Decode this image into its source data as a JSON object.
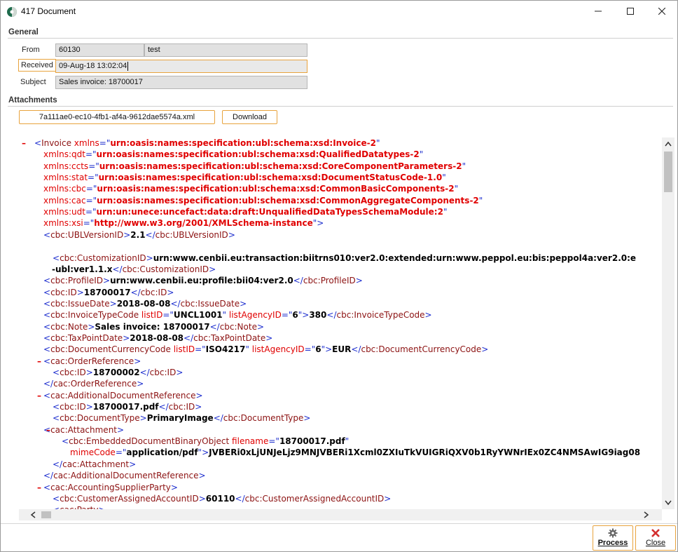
{
  "window": {
    "title": "417 Document"
  },
  "general": {
    "section_label": "General",
    "from_label": "From",
    "from_code": "60130",
    "from_name": "test",
    "received_label": "Received",
    "received_value": "09-Aug-18 13:02:04",
    "subject_label": "Subject",
    "subject_value": "Sales invoice: 18700017"
  },
  "attachments": {
    "section_label": "Attachments",
    "file_name": "7a111ae0-ec10-4fb1-af4a-9612dae5574a.xml",
    "download_label": "Download"
  },
  "xml_lines": [
    [
      {
        "c": "tg",
        "t": "<"
      },
      {
        "c": "tn",
        "t": "Invoice"
      },
      {
        "c": "an",
        "t": " xmlns"
      },
      {
        "c": "tg",
        "t": "=\""
      },
      {
        "c": "av",
        "t": "urn:oasis:names:specification:ubl:schema:xsd:Invoice-2"
      },
      {
        "c": "tg",
        "t": "\""
      }
    ],
    [
      {
        "c": "an",
        "t": "xmlns:qdt"
      },
      {
        "c": "tg",
        "t": "=\""
      },
      {
        "c": "av",
        "t": "urn:oasis:names:specification:ubl:schema:xsd:QualifiedDatatypes-2"
      },
      {
        "c": "tg",
        "t": "\""
      }
    ],
    [
      {
        "c": "an",
        "t": "xmlns:ccts"
      },
      {
        "c": "tg",
        "t": "=\""
      },
      {
        "c": "av",
        "t": "urn:oasis:names:specification:ubl:schema:xsd:CoreComponentParameters-2"
      },
      {
        "c": "tg",
        "t": "\""
      }
    ],
    [
      {
        "c": "an",
        "t": "xmlns:stat"
      },
      {
        "c": "tg",
        "t": "=\""
      },
      {
        "c": "av",
        "t": "urn:oasis:names:specification:ubl:schema:xsd:DocumentStatusCode-1.0"
      },
      {
        "c": "tg",
        "t": "\""
      }
    ],
    [
      {
        "c": "an",
        "t": "xmlns:cbc"
      },
      {
        "c": "tg",
        "t": "=\""
      },
      {
        "c": "av",
        "t": "urn:oasis:names:specification:ubl:schema:xsd:CommonBasicComponents-2"
      },
      {
        "c": "tg",
        "t": "\""
      }
    ],
    [
      {
        "c": "an",
        "t": "xmlns:cac"
      },
      {
        "c": "tg",
        "t": "=\""
      },
      {
        "c": "av",
        "t": "urn:oasis:names:specification:ubl:schema:xsd:CommonAggregateComponents-2"
      },
      {
        "c": "tg",
        "t": "\""
      }
    ],
    [
      {
        "c": "an",
        "t": "xmlns:udt"
      },
      {
        "c": "tg",
        "t": "=\""
      },
      {
        "c": "av",
        "t": "urn:un:unece:uncefact:data:draft:UnqualifiedDataTypesSchemaModule:2"
      },
      {
        "c": "tg",
        "t": "\""
      }
    ],
    [
      {
        "c": "an",
        "t": "xmlns:xsi"
      },
      {
        "c": "tg",
        "t": "=\""
      },
      {
        "c": "av",
        "t": "http://www.w3.org/2001/XMLSchema-instance"
      },
      {
        "c": "tg",
        "t": "\">"
      }
    ],
    [
      {
        "c": "tg",
        "t": "<"
      },
      {
        "c": "tn",
        "t": "cbc:UBLVersionID"
      },
      {
        "c": "tg",
        "t": ">"
      },
      {
        "c": "txt",
        "t": "2.1"
      },
      {
        "c": "tg",
        "t": "</"
      },
      {
        "c": "tn",
        "t": "cbc:UBLVersionID"
      },
      {
        "c": "tg",
        "t": ">"
      }
    ],
    [],
    [
      {
        "c": "tg",
        "t": "<"
      },
      {
        "c": "tn",
        "t": "cbc:CustomizationID"
      },
      {
        "c": "tg",
        "t": ">"
      },
      {
        "c": "txt",
        "t": "urn:www.cenbii.eu:transaction:biitrns010:ver2.0:extended:urn:www.peppol.eu:bis:peppol4a:ver2.0:e"
      }
    ],
    [
      {
        "c": "txt",
        "t": "-ubl:ver1.1.x"
      },
      {
        "c": "tg",
        "t": "</"
      },
      {
        "c": "tn",
        "t": "cbc:CustomizationID"
      },
      {
        "c": "tg",
        "t": ">"
      }
    ],
    [
      {
        "c": "tg",
        "t": "<"
      },
      {
        "c": "tn",
        "t": "cbc:ProfileID"
      },
      {
        "c": "tg",
        "t": ">"
      },
      {
        "c": "txt",
        "t": "urn:www.cenbii.eu:profile:bii04:ver2.0"
      },
      {
        "c": "tg",
        "t": "</"
      },
      {
        "c": "tn",
        "t": "cbc:ProfileID"
      },
      {
        "c": "tg",
        "t": ">"
      }
    ],
    [
      {
        "c": "tg",
        "t": "<"
      },
      {
        "c": "tn",
        "t": "cbc:ID"
      },
      {
        "c": "tg",
        "t": ">"
      },
      {
        "c": "txt",
        "t": "18700017"
      },
      {
        "c": "tg",
        "t": "</"
      },
      {
        "c": "tn",
        "t": "cbc:ID"
      },
      {
        "c": "tg",
        "t": ">"
      }
    ],
    [
      {
        "c": "tg",
        "t": "<"
      },
      {
        "c": "tn",
        "t": "cbc:IssueDate"
      },
      {
        "c": "tg",
        "t": ">"
      },
      {
        "c": "txt",
        "t": "2018-08-08"
      },
      {
        "c": "tg",
        "t": "</"
      },
      {
        "c": "tn",
        "t": "cbc:IssueDate"
      },
      {
        "c": "tg",
        "t": ">"
      }
    ],
    [
      {
        "c": "tg",
        "t": "<"
      },
      {
        "c": "tn",
        "t": "cbc:InvoiceTypeCode"
      },
      {
        "c": "an",
        "t": " listID"
      },
      {
        "c": "tg",
        "t": "=\""
      },
      {
        "c": "txt",
        "t": "UNCL1001"
      },
      {
        "c": "tg",
        "t": "\""
      },
      {
        "c": "an",
        "t": " listAgencyID"
      },
      {
        "c": "tg",
        "t": "=\""
      },
      {
        "c": "txt",
        "t": "6"
      },
      {
        "c": "tg",
        "t": "\">"
      },
      {
        "c": "txt",
        "t": "380"
      },
      {
        "c": "tg",
        "t": "</"
      },
      {
        "c": "tn",
        "t": "cbc:InvoiceTypeCode"
      },
      {
        "c": "tg",
        "t": ">"
      }
    ],
    [
      {
        "c": "tg",
        "t": "<"
      },
      {
        "c": "tn",
        "t": "cbc:Note"
      },
      {
        "c": "tg",
        "t": ">"
      },
      {
        "c": "txt",
        "t": "Sales invoice: 18700017"
      },
      {
        "c": "tg",
        "t": "</"
      },
      {
        "c": "tn",
        "t": "cbc:Note"
      },
      {
        "c": "tg",
        "t": ">"
      }
    ],
    [
      {
        "c": "tg",
        "t": "<"
      },
      {
        "c": "tn",
        "t": "cbc:TaxPointDate"
      },
      {
        "c": "tg",
        "t": ">"
      },
      {
        "c": "txt",
        "t": "2018-08-08"
      },
      {
        "c": "tg",
        "t": "</"
      },
      {
        "c": "tn",
        "t": "cbc:TaxPointDate"
      },
      {
        "c": "tg",
        "t": ">"
      }
    ],
    [
      {
        "c": "tg",
        "t": "<"
      },
      {
        "c": "tn",
        "t": "cbc:DocumentCurrencyCode"
      },
      {
        "c": "an",
        "t": " listID"
      },
      {
        "c": "tg",
        "t": "=\""
      },
      {
        "c": "txt",
        "t": "ISO4217"
      },
      {
        "c": "tg",
        "t": "\""
      },
      {
        "c": "an",
        "t": " listAgencyID"
      },
      {
        "c": "tg",
        "t": "=\""
      },
      {
        "c": "txt",
        "t": "6"
      },
      {
        "c": "tg",
        "t": "\">"
      },
      {
        "c": "txt",
        "t": "EUR"
      },
      {
        "c": "tg",
        "t": "</"
      },
      {
        "c": "tn",
        "t": "cbc:DocumentCurrencyCode"
      },
      {
        "c": "tg",
        "t": ">"
      }
    ],
    [
      {
        "c": "tg",
        "t": "<"
      },
      {
        "c": "tn",
        "t": "cac:OrderReference"
      },
      {
        "c": "tg",
        "t": ">"
      }
    ],
    [
      {
        "c": "tg",
        "t": "<"
      },
      {
        "c": "tn",
        "t": "cbc:ID"
      },
      {
        "c": "tg",
        "t": ">"
      },
      {
        "c": "txt",
        "t": "18700002"
      },
      {
        "c": "tg",
        "t": "</"
      },
      {
        "c": "tn",
        "t": "cbc:ID"
      },
      {
        "c": "tg",
        "t": ">"
      }
    ],
    [
      {
        "c": "tg",
        "t": "</"
      },
      {
        "c": "tn",
        "t": "cac:OrderReference"
      },
      {
        "c": "tg",
        "t": ">"
      }
    ],
    [
      {
        "c": "tg",
        "t": "<"
      },
      {
        "c": "tn",
        "t": "cac:AdditionalDocumentReference"
      },
      {
        "c": "tg",
        "t": ">"
      }
    ],
    [
      {
        "c": "tg",
        "t": "<"
      },
      {
        "c": "tn",
        "t": "cbc:ID"
      },
      {
        "c": "tg",
        "t": ">"
      },
      {
        "c": "txt",
        "t": "18700017.pdf"
      },
      {
        "c": "tg",
        "t": "</"
      },
      {
        "c": "tn",
        "t": "cbc:ID"
      },
      {
        "c": "tg",
        "t": ">"
      }
    ],
    [
      {
        "c": "tg",
        "t": "<"
      },
      {
        "c": "tn",
        "t": "cbc:DocumentType"
      },
      {
        "c": "tg",
        "t": ">"
      },
      {
        "c": "txt",
        "t": "PrimaryImage"
      },
      {
        "c": "tg",
        "t": "</"
      },
      {
        "c": "tn",
        "t": "cbc:DocumentType"
      },
      {
        "c": "tg",
        "t": ">"
      }
    ],
    [
      {
        "c": "tg",
        "t": "<"
      },
      {
        "c": "tn",
        "t": "cac:Attachment"
      },
      {
        "c": "tg",
        "t": ">"
      }
    ],
    [
      {
        "c": "tg",
        "t": "<"
      },
      {
        "c": "tn",
        "t": "cbc:EmbeddedDocumentBinaryObject"
      },
      {
        "c": "an",
        "t": " filename"
      },
      {
        "c": "tg",
        "t": "=\""
      },
      {
        "c": "txt",
        "t": "18700017.pdf"
      },
      {
        "c": "tg",
        "t": "\""
      }
    ],
    [
      {
        "c": "an",
        "t": "mimeCode"
      },
      {
        "c": "tg",
        "t": "=\""
      },
      {
        "c": "txt",
        "t": "application/pdf"
      },
      {
        "c": "tg",
        "t": "\">"
      },
      {
        "c": "txt",
        "t": "JVBERi0xLjUNJeLjz9MNJVBERi1Xcml0ZXIuTkVUIGRiQXV0b1RyYWNrIEx0ZC4NMSAwIG9iag08"
      }
    ],
    [
      {
        "c": "tg",
        "t": "</"
      },
      {
        "c": "tn",
        "t": "cac:Attachment"
      },
      {
        "c": "tg",
        "t": ">"
      }
    ],
    [
      {
        "c": "tg",
        "t": "</"
      },
      {
        "c": "tn",
        "t": "cac:AdditionalDocumentReference"
      },
      {
        "c": "tg",
        "t": ">"
      }
    ],
    [
      {
        "c": "tg",
        "t": "<"
      },
      {
        "c": "tn",
        "t": "cac:AccountingSupplierParty"
      },
      {
        "c": "tg",
        "t": ">"
      }
    ],
    [
      {
        "c": "tg",
        "t": "<"
      },
      {
        "c": "tn",
        "t": "cbc:CustomerAssignedAccountID"
      },
      {
        "c": "tg",
        "t": ">"
      },
      {
        "c": "txt",
        "t": "60110"
      },
      {
        "c": "tg",
        "t": "</"
      },
      {
        "c": "tn",
        "t": "cbc:CustomerAssignedAccountID"
      },
      {
        "c": "tg",
        "t": ">"
      }
    ],
    [
      {
        "c": "tg",
        "t": "<"
      },
      {
        "c": "tn",
        "t": "cac:Party"
      },
      {
        "c": "tg",
        "t": ">"
      }
    ]
  ],
  "xml_toggle": "–",
  "footer": {
    "process_label": "Process",
    "close_label": "Close"
  },
  "colors": {
    "accent_border": "#e8a33d",
    "close_icon": "#d32f2f",
    "xml_tag": "#1c2dce",
    "xml_name": "#8c1212",
    "xml_attr": "#e00000"
  }
}
